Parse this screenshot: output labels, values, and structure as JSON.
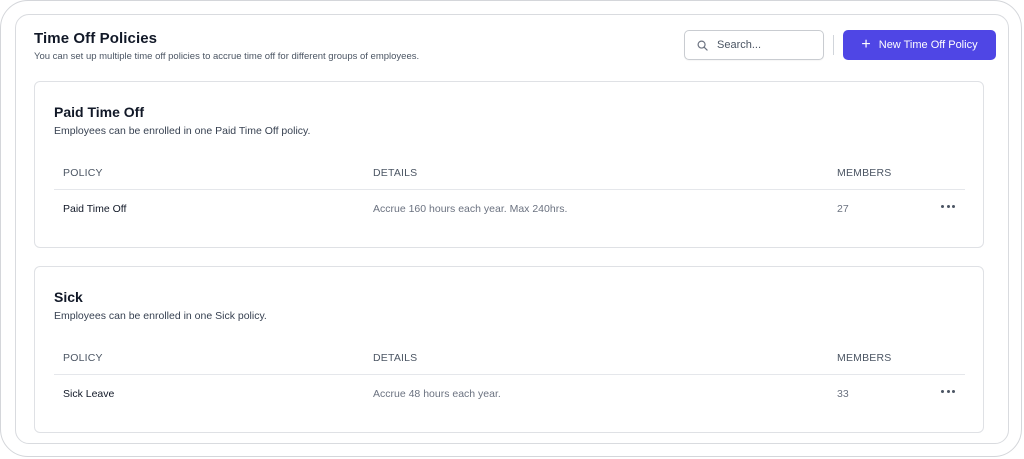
{
  "header": {
    "title": "Time Off Policies",
    "subtitle": "You can set up multiple time off policies to accrue time off for different groups of employees."
  },
  "search": {
    "placeholder": "Search...",
    "value": ""
  },
  "new_policy_button": {
    "label": "New Time Off Policy",
    "icon": "plus-icon"
  },
  "accent_color": "#4f46e5",
  "sections": [
    {
      "title": "Paid Time Off",
      "description": "Employees can be enrolled in one Paid Time Off policy.",
      "columns": {
        "policy": "POLICY",
        "details": "DETAILS",
        "members": "MEMBERS"
      },
      "rows": [
        {
          "policy": "Paid Time Off",
          "details": "Accrue 160 hours each year. Max 240hrs.",
          "members": "27",
          "actions_icon": "more-horizontal-icon"
        }
      ]
    },
    {
      "title": "Sick",
      "description": "Employees can be enrolled in one Sick policy.",
      "columns": {
        "policy": "POLICY",
        "details": "DETAILS",
        "members": "MEMBERS"
      },
      "rows": [
        {
          "policy": "Sick Leave",
          "details": "Accrue 48 hours each year.",
          "members": "33",
          "actions_icon": "more-horizontal-icon"
        }
      ]
    }
  ]
}
